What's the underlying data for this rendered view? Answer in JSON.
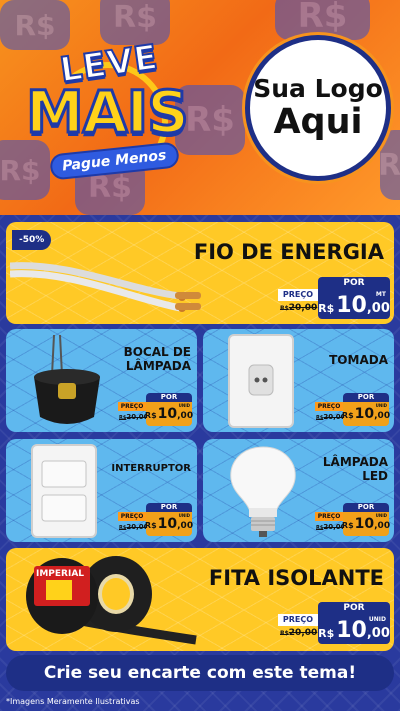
{
  "header": {
    "brand_line1": "LEVE",
    "brand_line2": "MAIS",
    "brand_line3": "Pague Menos",
    "logo_line1": "Sua Logo",
    "logo_line2": "Aqui",
    "bg_symbol": "R$"
  },
  "products": [
    {
      "name": "FIO DE ENERGIA",
      "discount": "-50%",
      "label_por": "POR",
      "label_preco": "PREÇO",
      "old_price": "20,00",
      "currency": "R$",
      "price_int": "10",
      "price_dec": ",00",
      "unit": "MT",
      "old_prefix": "R$"
    },
    {
      "name": "BOCAL DE LÂMPADA",
      "label_por": "POR",
      "label_preco": "PREÇO",
      "old_price": "20,00",
      "currency": "R$",
      "price_int": "10",
      "price_dec": ",00",
      "unit": "UNID",
      "old_prefix": "R$"
    },
    {
      "name": "TOMADA",
      "label_por": "POR",
      "label_preco": "PREÇO",
      "old_price": "20,00",
      "currency": "R$",
      "price_int": "10",
      "price_dec": ",00",
      "unit": "UNID",
      "old_prefix": "R$"
    },
    {
      "name": "INTERRUPTOR",
      "label_por": "POR",
      "label_preco": "PREÇO",
      "old_price": "20,00",
      "currency": "R$",
      "price_int": "10",
      "price_dec": ",00",
      "unit": "UNID",
      "old_prefix": "R$"
    },
    {
      "name": "LÂMPADA LED",
      "label_por": "POR",
      "label_preco": "PREÇO",
      "old_price": "20,00",
      "currency": "R$",
      "price_int": "10",
      "price_dec": ",00",
      "unit": "UNID",
      "old_prefix": "R$"
    },
    {
      "name": "FITA ISOLANTE",
      "label_por": "POR",
      "label_preco": "PREÇO",
      "old_price": "20,00",
      "currency": "R$",
      "price_int": "10",
      "price_dec": ",00",
      "unit": "UNID",
      "old_prefix": "R$"
    }
  ],
  "tape_brand": "IMPERIAL",
  "cta": "Crie seu encarte com este tema!",
  "footnote": "*Imagens Meramente Ilustrativas",
  "colors": {
    "navy": "#1e2f86",
    "yellow": "#ffc926",
    "sky": "#5fb8ee",
    "orange": "#f7931e"
  }
}
